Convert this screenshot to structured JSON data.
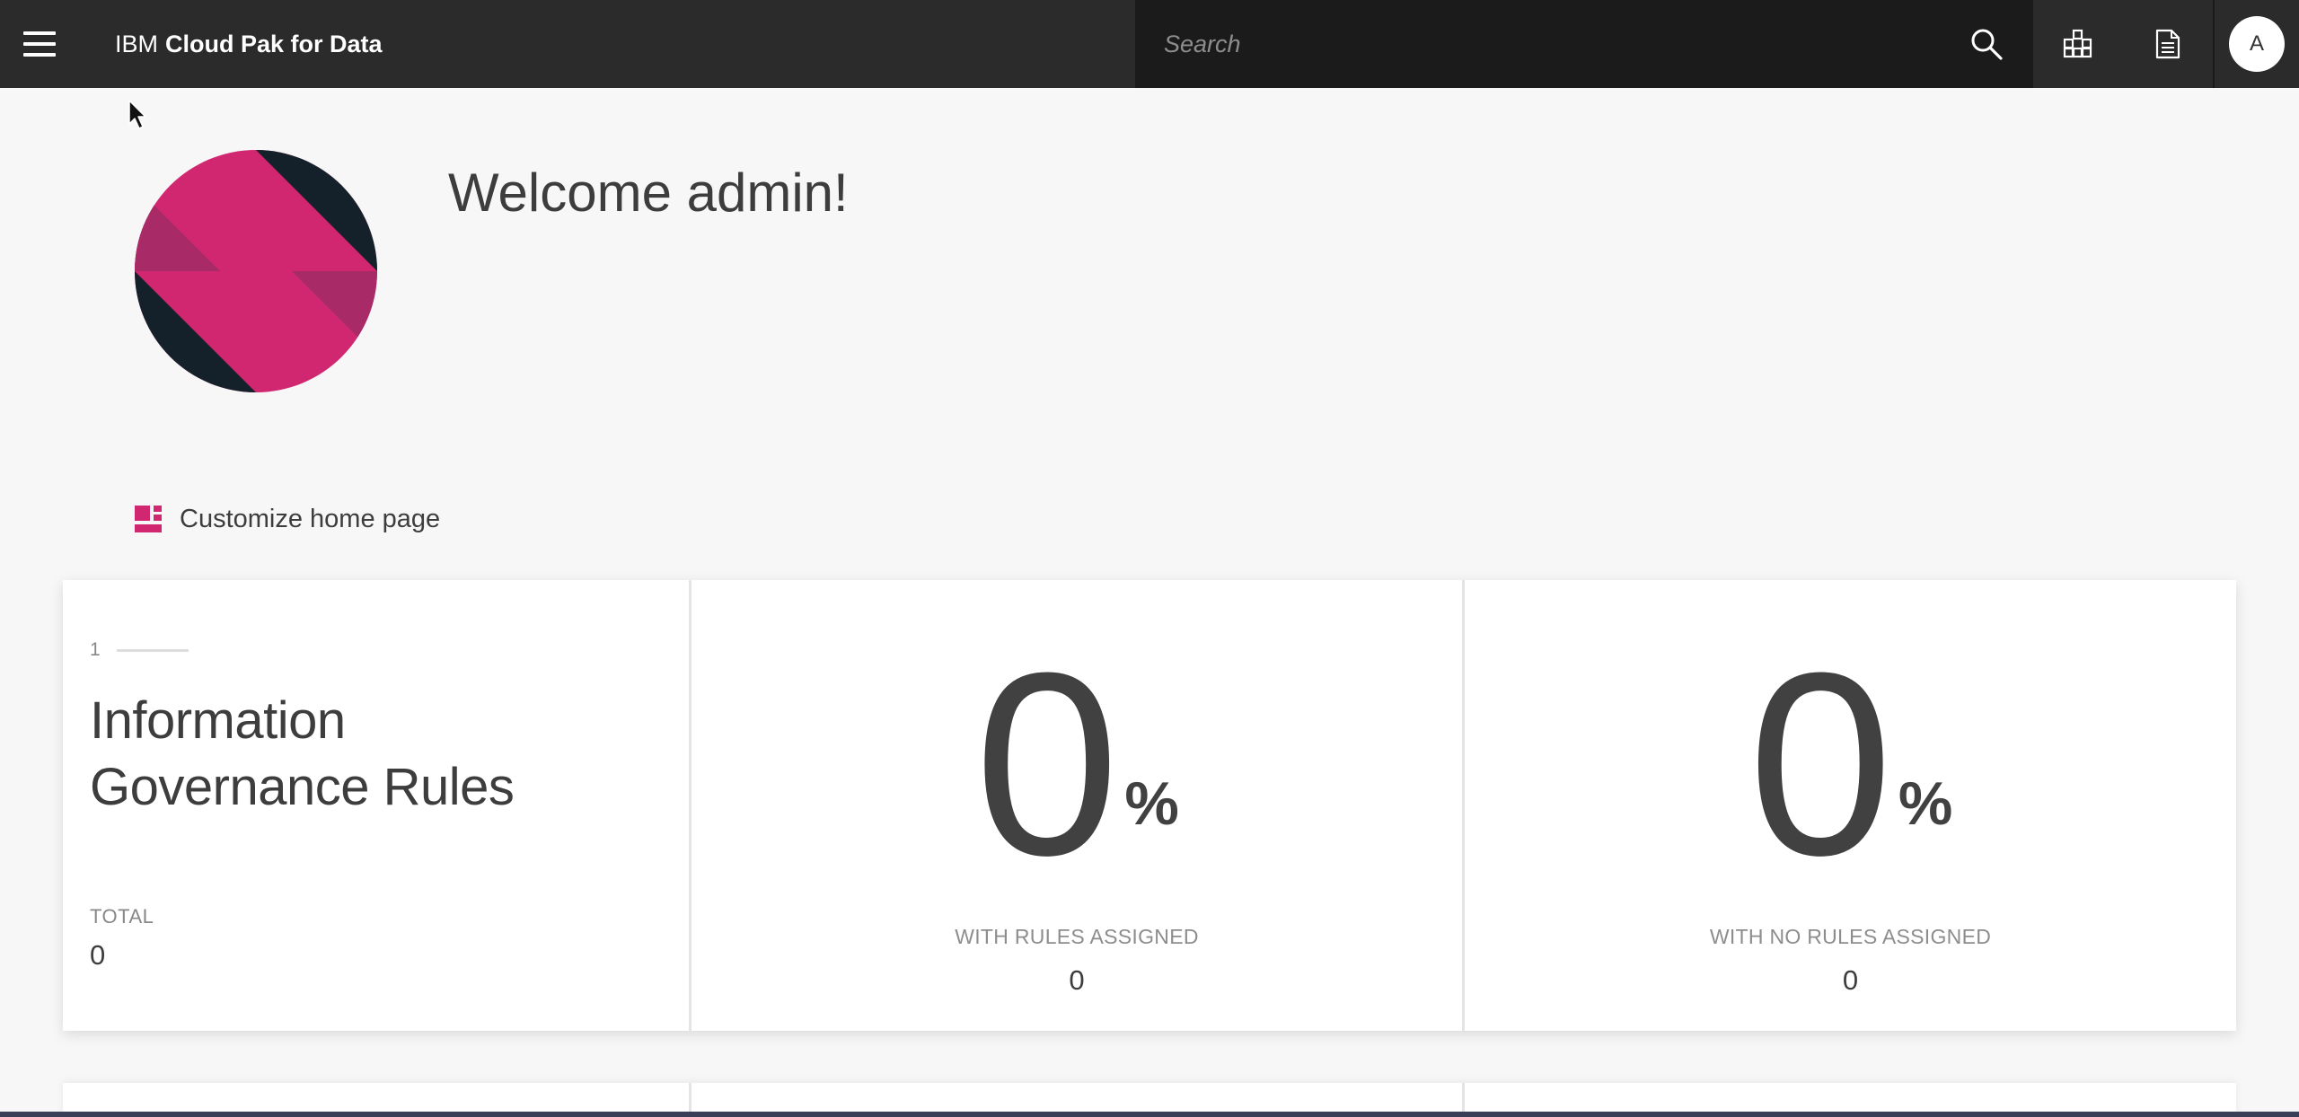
{
  "header": {
    "brand_prefix": "IBM",
    "brand_name": "Cloud Pak for Data",
    "search_placeholder": "Search",
    "avatar_initial": "A"
  },
  "welcome": {
    "title": "Welcome admin!"
  },
  "customize": {
    "label": "Customize home page",
    "icon_color": "#d12771"
  },
  "rules_card": {
    "index": "1",
    "title": "Information Governance Rules",
    "total_label": "TOTAL",
    "total_value": "0"
  },
  "stats": [
    {
      "big": "0",
      "unit": "%",
      "label": "WITH RULES ASSIGNED",
      "value": "0"
    },
    {
      "big": "0",
      "unit": "%",
      "label": "WITH NO RULES ASSIGNED",
      "value": "0"
    }
  ],
  "colors": {
    "header_bg": "#2b2b2b",
    "search_bg": "#1b1b1b",
    "accent_magenta": "#d12771",
    "page_bg": "#f7f7f7"
  }
}
